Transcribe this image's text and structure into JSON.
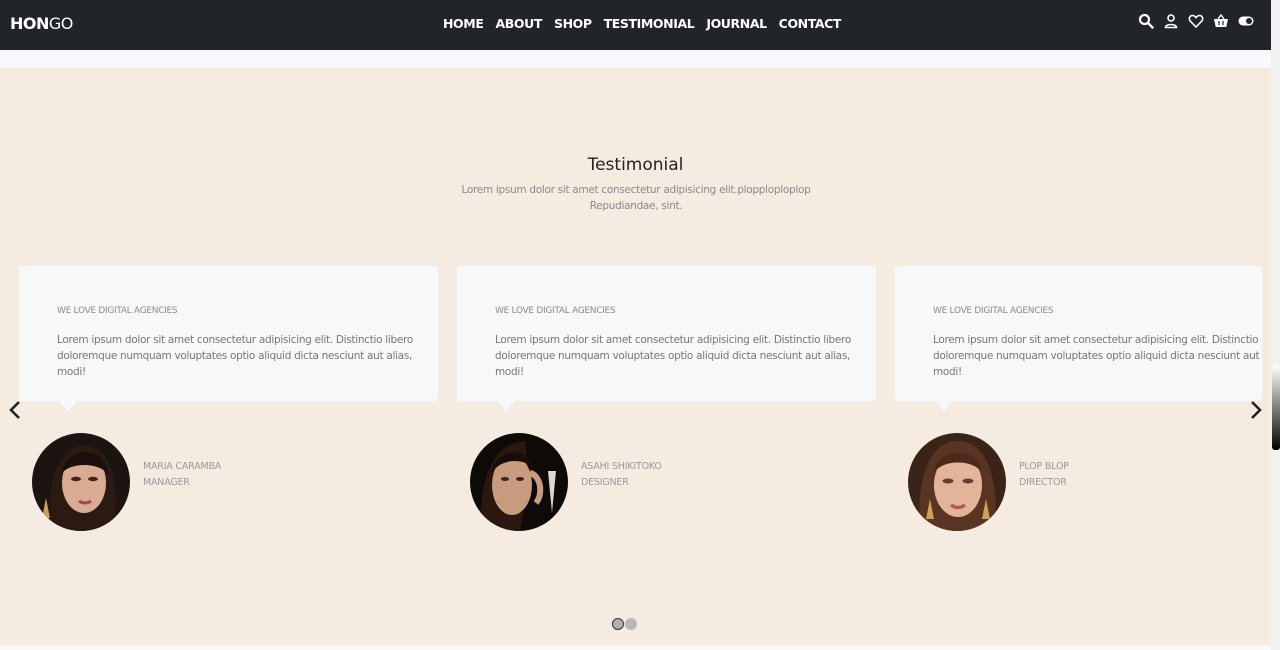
{
  "header": {
    "logo_bold": "HON",
    "logo_thin": "GO",
    "nav": [
      "HOME",
      "ABOUT",
      "SHOP",
      "TESTIMONIAL",
      "JOURNAL",
      "CONTACT"
    ],
    "icons": [
      "search-icon",
      "user-icon",
      "heart-icon",
      "basket-icon",
      "toggle-icon"
    ]
  },
  "section": {
    "title": "Testimonial",
    "subtitle": "Lorem ipsum dolor sit amet consectetur adipisicing elit.plopploploplop Repudiandae, sint."
  },
  "testimonials": [
    {
      "tag": "WE LOVE DIGITAL AGENCIES",
      "text": "Lorem ipsum dolor sit amet consectetur adipisicing elit. Distinctio libero doloremque numquam voluptates optio aliquid dicta nesciunt aut alias, modi!",
      "name": "MARIA CARAMBA",
      "role": "MANAGER"
    },
    {
      "tag": "WE LOVE DIGITAL AGENCIES",
      "text": "Lorem ipsum dolor sit amet consectetur adipisicing elit. Distinctio libero doloremque numquam voluptates optio aliquid dicta nesciunt aut alias, modi!",
      "name": "ASAHI SHIKITOKO",
      "role": "DESIGNER"
    },
    {
      "tag": "WE LOVE DIGITAL AGENCIES",
      "text": "Lorem ipsum dolor sit amet consectetur adipisicing elit. Distinctio libero doloremque numquam voluptates optio aliquid dicta nesciunt aut alias, modi!",
      "name": "PLOP BLOP",
      "role": "DIRECTOR"
    }
  ],
  "carousel": {
    "prev_icon": "chevron-left-icon",
    "next_icon": "chevron-right-icon",
    "active_page": 1,
    "pages": 2
  },
  "colors": {
    "navbar": "#212529",
    "section_bg": "#f6ebe1",
    "card_bg": "#f7f8fa"
  }
}
